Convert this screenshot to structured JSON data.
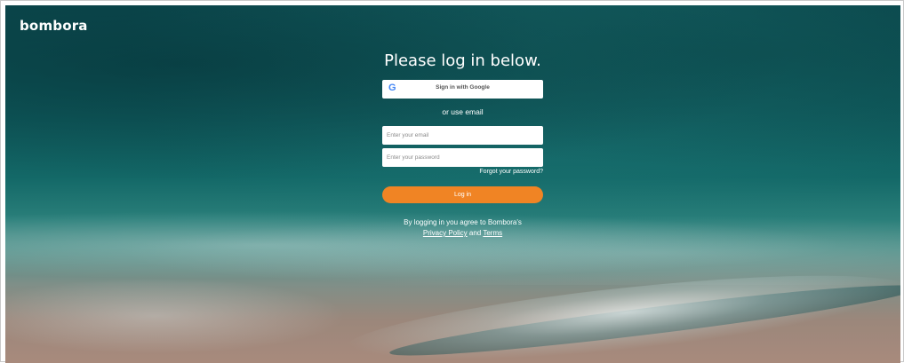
{
  "brand": {
    "logo_text": "bombora"
  },
  "login": {
    "heading": "Please log in below.",
    "google_button_label": "Sign in with Google",
    "google_icon_glyph": "G",
    "or_text": "or use email",
    "email_placeholder": "Enter your email",
    "password_placeholder": "Enter your password",
    "forgot_password_label": "Forgot your password?",
    "login_button_label": "Log in",
    "agreement_text": "By logging in you agree to Bombora's",
    "privacy_link_label": "Privacy Policy",
    "and_text": "and",
    "terms_link_label": "Terms"
  },
  "colors": {
    "accent": "#f08424",
    "google_blue": "#4285F4"
  },
  "icons": {
    "google": "google-icon"
  }
}
